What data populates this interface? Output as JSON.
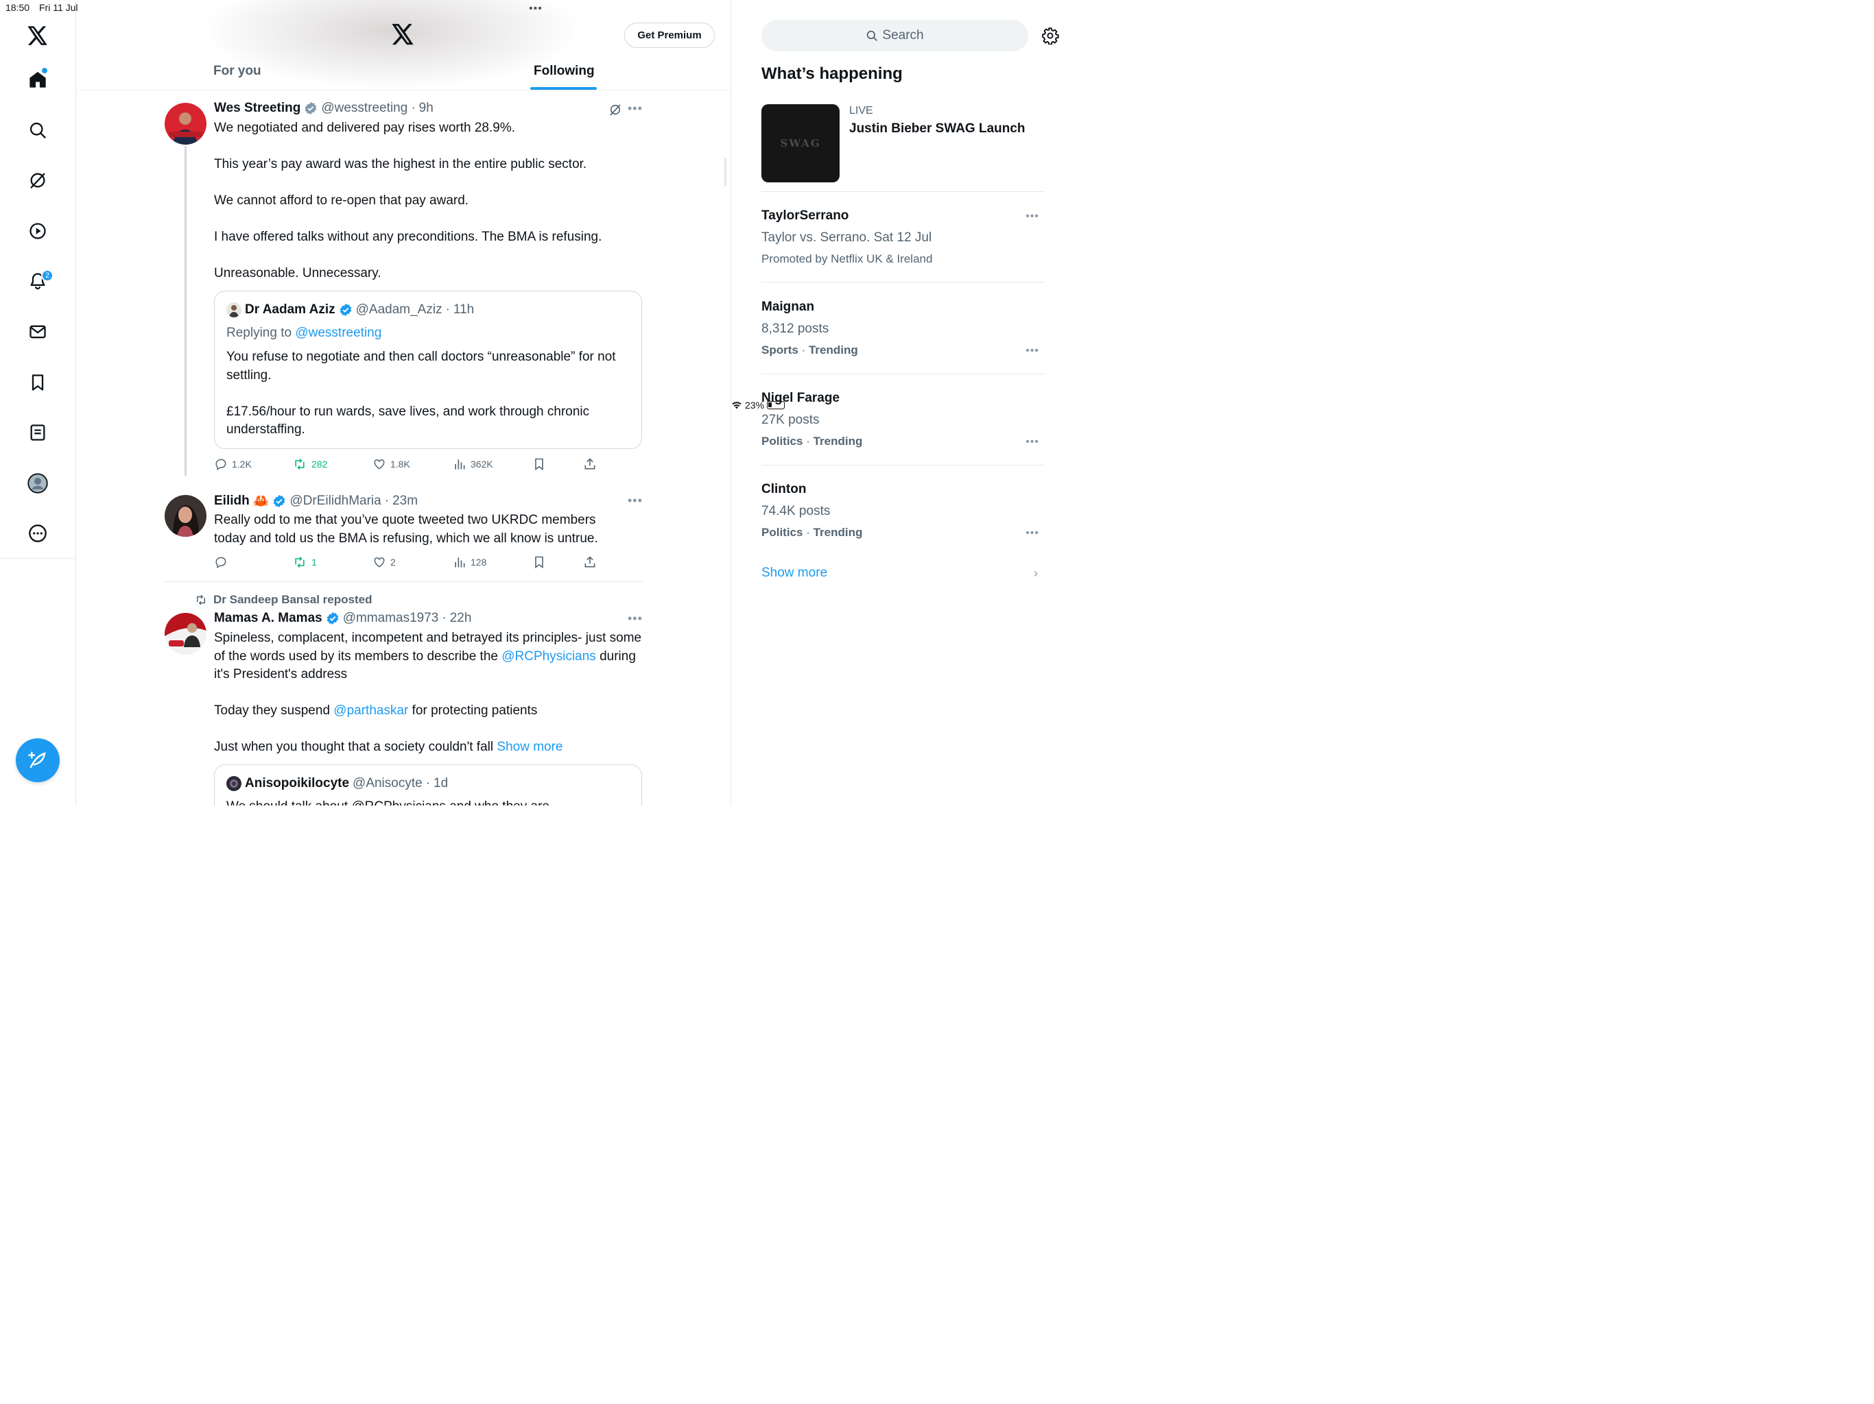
{
  "status_bar": {
    "time": "18:50",
    "date": "Fri 11 Jul",
    "battery": "23%"
  },
  "sidebar": {
    "notification_count": "2"
  },
  "header": {
    "premium_label": "Get Premium",
    "tabs": [
      "For you",
      "Following"
    ],
    "active_tab": "Following"
  },
  "tweets": [
    {
      "name": "Wes Streeting",
      "handle": "@wesstreeting",
      "time": "9h",
      "paragraphs": [
        "We negotiated and delivered pay rises worth 28.9%.",
        "This year’s pay award was the highest in the entire public sector.",
        "We cannot afford to re-open that pay award.",
        "I have offered talks without any preconditions. The BMA is refusing.",
        "Unreasonable. Unnecessary."
      ],
      "quote": {
        "name": "Dr Aadam Aziz",
        "handle": "@Aadam_Aziz",
        "time": "11h",
        "replying_prefix": "Replying to",
        "replying_to": "@wesstreeting",
        "paragraphs": [
          "You refuse to negotiate and then call doctors “unreasonable” for not settling.",
          "£17.56/hour to run wards, save lives, and work through chronic understaffing."
        ]
      },
      "stats": {
        "replies": "1.2K",
        "reposts": "282",
        "likes": "1.8K",
        "views": "362K"
      }
    },
    {
      "name": "Eilidh",
      "emoji": "🦀",
      "handle": "@DrEilidhMaria",
      "time": "23m",
      "text": "Really odd to me that you’ve quote tweeted two UKRDC members today and told us the BMA is refusing, which we all know is untrue.",
      "stats": {
        "replies": "",
        "reposts": "1",
        "likes": "2",
        "views": "128"
      }
    },
    {
      "reposted_by": "Dr Sandeep Bansal reposted",
      "name": "Mamas A. Mamas",
      "handle": "@mmamas1973",
      "time": "22h",
      "p1_a": "Spineless, complacent, incompetent and betrayed its principles- just some of the words used by its members to describe the",
      "p1_link": "@RCPhysicians",
      "p1_b": "during it's President's address",
      "p2_a": "Today they suspend",
      "p2_link": "@parthaskar",
      "p2_b": "for protecting patients",
      "p3": "Just when you thought that a society couldn't fall",
      "show_more": "Show more",
      "quote": {
        "name": "Anisopoikilocyte",
        "handle": "@Anisocyte",
        "time": "1d",
        "text": "We should talk about @RCPhysicians and who they are"
      }
    }
  ],
  "right": {
    "search_placeholder": "Search",
    "heading": "What’s happening",
    "live": {
      "thumb_text": "SWAG",
      "label": "LIVE",
      "title": "Justin Bieber SWAG Launch"
    },
    "trends": [
      {
        "title": "TaylorSerrano",
        "subtitle": "Taylor vs. Serrano. Sat 12 Jul",
        "meta": "Promoted by Netflix UK & Ireland"
      },
      {
        "title": "Maignan",
        "subtitle": "8,312 posts",
        "meta_bold": "Sports",
        "meta_rest": "Trending"
      },
      {
        "title": "Nigel Farage",
        "subtitle": "27K posts",
        "meta_bold": "Politics",
        "meta_rest": "Trending"
      },
      {
        "title": "Clinton",
        "subtitle": "74.4K posts",
        "meta_bold": "Politics",
        "meta_rest": "Trending"
      }
    ],
    "show_more": "Show more"
  },
  "colors": {
    "accent": "#1d9bf0",
    "repost_green": "#00ba7c",
    "muted": "#536471"
  }
}
